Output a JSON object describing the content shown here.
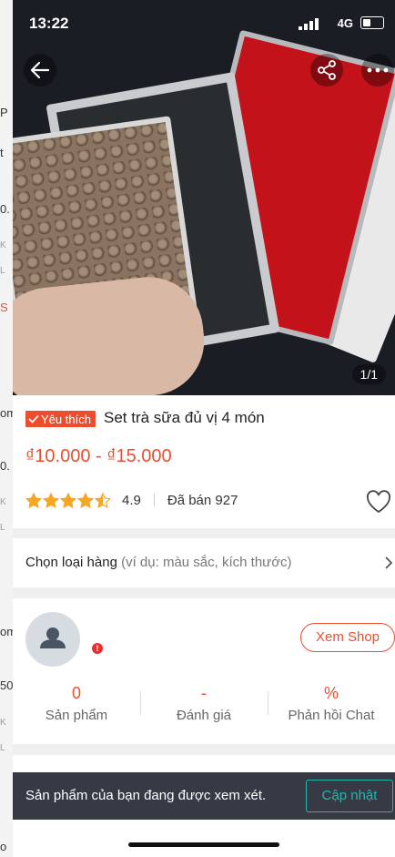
{
  "status_bar": {
    "time": "13:22",
    "network": "4G"
  },
  "hero": {
    "image_counter": "1/1"
  },
  "background_page": {
    "fragments": [
      "P",
      "t",
      "0.",
      "K",
      "L",
      "S",
      "om",
      "0.",
      "K",
      "L",
      "om",
      "50",
      "K",
      "L",
      "o"
    ]
  },
  "product": {
    "badge": "Yêu thích",
    "title": "Set trà sữa đủ vị 4 món",
    "price": "₫10.000 - ₫15.000",
    "rating": "4.9",
    "rating_stars": 4.5,
    "sold": "Đã bán 927"
  },
  "variant": {
    "label": "Chọn loại hàng",
    "hint": "(ví dụ: màu sắc, kích thước)"
  },
  "shop": {
    "notification_dot": "!",
    "view_shop_label": "Xem Shop",
    "stats": [
      {
        "value": "0",
        "label": "Sản phẩm"
      },
      {
        "value": "-",
        "label": "Đánh giá"
      },
      {
        "value": "%",
        "label": "Phản hồi Chat"
      }
    ]
  },
  "toast": {
    "message": "Sản phẩm của bạn đang được xem xét.",
    "button": "Cập nhật"
  },
  "colors": {
    "accent": "#ee4d2d",
    "star": "#f5a623",
    "toast_bg": "#363a45",
    "toast_button": "#24b6b0"
  }
}
